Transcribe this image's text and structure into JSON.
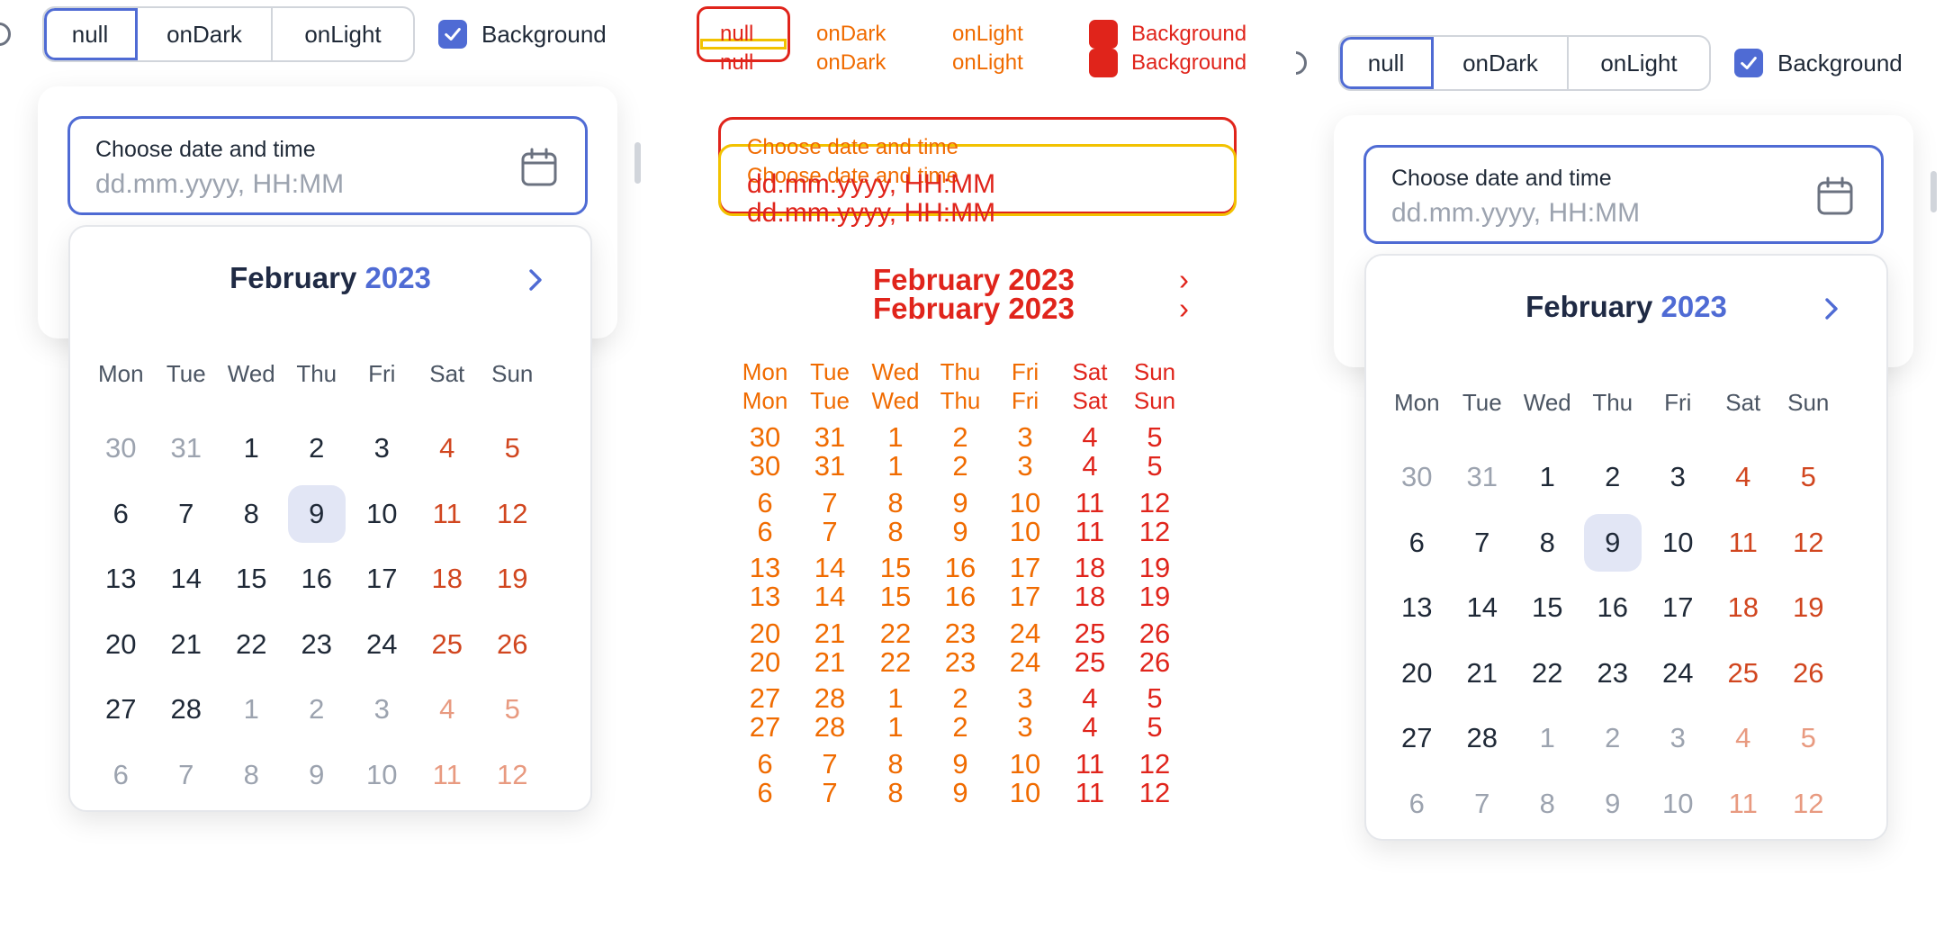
{
  "controls": {
    "options": [
      "null",
      "onDark",
      "onLight"
    ],
    "selected": "null",
    "background_label": "Background",
    "background_checked": true
  },
  "field": {
    "label": "Choose date and time",
    "placeholder": "dd.mm.yyyy, HH:MM"
  },
  "calendar": {
    "month": "February",
    "year": "2023",
    "weekdays": [
      "Mon",
      "Tue",
      "Wed",
      "Thu",
      "Fri",
      "Sat",
      "Sun"
    ],
    "weeks": [
      [
        "30",
        "31",
        "1",
        "2",
        "3",
        "4",
        "5"
      ],
      [
        "6",
        "7",
        "8",
        "9",
        "10",
        "11",
        "12"
      ],
      [
        "13",
        "14",
        "15",
        "16",
        "17",
        "18",
        "19"
      ],
      [
        "20",
        "21",
        "22",
        "23",
        "24",
        "25",
        "26"
      ],
      [
        "27",
        "28",
        "1",
        "2",
        "3",
        "4",
        "5"
      ],
      [
        "6",
        "7",
        "8",
        "9",
        "10",
        "11",
        "12"
      ]
    ],
    "selected_day": "9"
  },
  "colors": {
    "accent": "#4f6bd4",
    "weekend": "#d1461f",
    "selected_bg": "#e2e6f5",
    "diff_red": "#e0241b",
    "diff_orange": "#f06b00",
    "diff_yellow": "#f2c200"
  }
}
